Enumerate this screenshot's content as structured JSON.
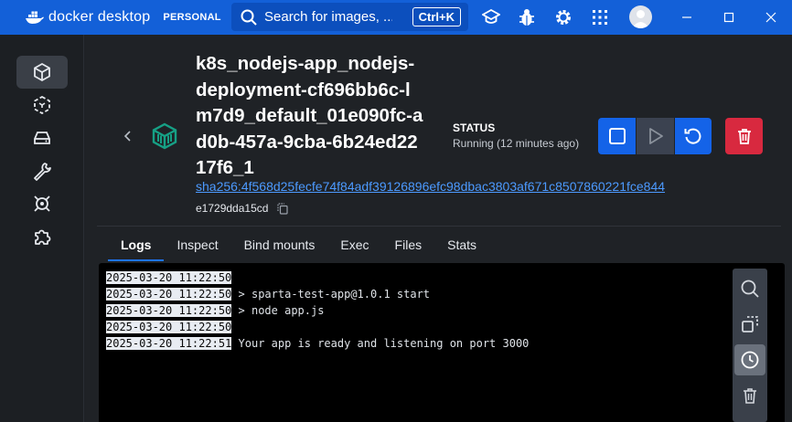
{
  "app": {
    "brand": "docker desktop",
    "plan": "PERSONAL",
    "search_placeholder": "Search for images, ...",
    "search_shortcut": "Ctrl+K"
  },
  "titlebar_icons": [
    "learning-center-icon",
    "troubleshoot-bug-icon",
    "settings-gear-icon",
    "extensions-grid-icon",
    "user-avatar-icon"
  ],
  "sidebar": {
    "items": [
      {
        "name": "containers",
        "icon": "container-cube-icon",
        "active": true
      },
      {
        "name": "images",
        "icon": "image-cube-icon",
        "active": false
      },
      {
        "name": "volumes",
        "icon": "volume-drive-icon",
        "active": false
      },
      {
        "name": "builds",
        "icon": "wrench-icon",
        "active": false
      },
      {
        "name": "docker-scout",
        "icon": "scout-icon",
        "active": false
      },
      {
        "name": "extensions",
        "icon": "puzzle-icon",
        "active": false
      }
    ]
  },
  "container": {
    "name": "k8s_nodejs-app_nodejs-deployment-cf696bb6c-lm7d9_default_01e090fc-ad0b-457a-9cba-6b24ed2217f6_1",
    "image_sha": "sha256:4f568d25fecfe74f84adf39126896efc98dbac3803af671c8507860221fce844",
    "id": "e1729dda15cd",
    "status_label": "STATUS",
    "status_value": "Running (12 minutes ago)"
  },
  "tabs": [
    {
      "label": "Logs",
      "active": true
    },
    {
      "label": "Inspect",
      "active": false
    },
    {
      "label": "Bind mounts",
      "active": false
    },
    {
      "label": "Exec",
      "active": false
    },
    {
      "label": "Files",
      "active": false
    },
    {
      "label": "Stats",
      "active": false
    }
  ],
  "logs": [
    {
      "ts": "2025-03-20 11:22:50",
      "msg": ""
    },
    {
      "ts": "2025-03-20 11:22:50",
      "msg": "> sparta-test-app@1.0.1 start"
    },
    {
      "ts": "2025-03-20 11:22:50",
      "msg": "> node app.js"
    },
    {
      "ts": "2025-03-20 11:22:50",
      "msg": ""
    },
    {
      "ts": "2025-03-20 11:22:51",
      "msg": "Your app is ready and listening on port 3000"
    }
  ],
  "colors": {
    "titlebar": "#1360d8",
    "primary": "#1463e8",
    "danger": "#d8293f",
    "link": "#4c9aff",
    "container_icon": "#16a085"
  }
}
